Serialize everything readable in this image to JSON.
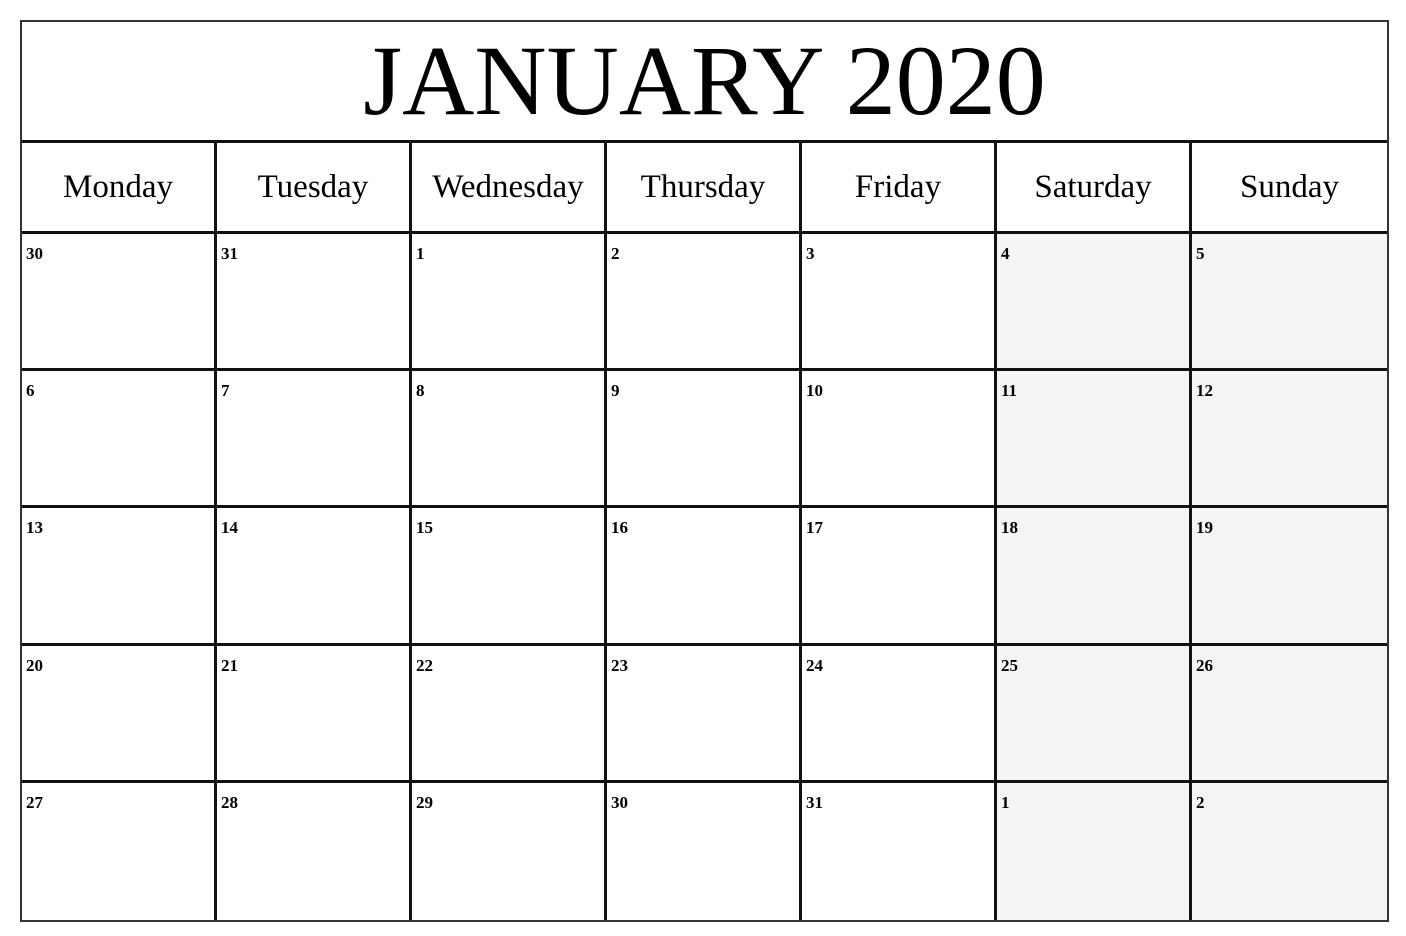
{
  "calendar": {
    "title": "JANUARY 2020",
    "weekdays": [
      "Monday",
      "Tuesday",
      "Wednesday",
      "Thursday",
      "Friday",
      "Saturday",
      "Sunday"
    ],
    "weekend_color": "#f4f4f4",
    "weeks": [
      [
        "30",
        "31",
        "1",
        "2",
        "3",
        "4",
        "5"
      ],
      [
        "6",
        "7",
        "8",
        "9",
        "10",
        "11",
        "12"
      ],
      [
        "13",
        "14",
        "15",
        "16",
        "17",
        "18",
        "19"
      ],
      [
        "20",
        "21",
        "22",
        "23",
        "24",
        "25",
        "26"
      ],
      [
        "27",
        "28",
        "29",
        "30",
        "31",
        "1",
        "2"
      ]
    ]
  }
}
